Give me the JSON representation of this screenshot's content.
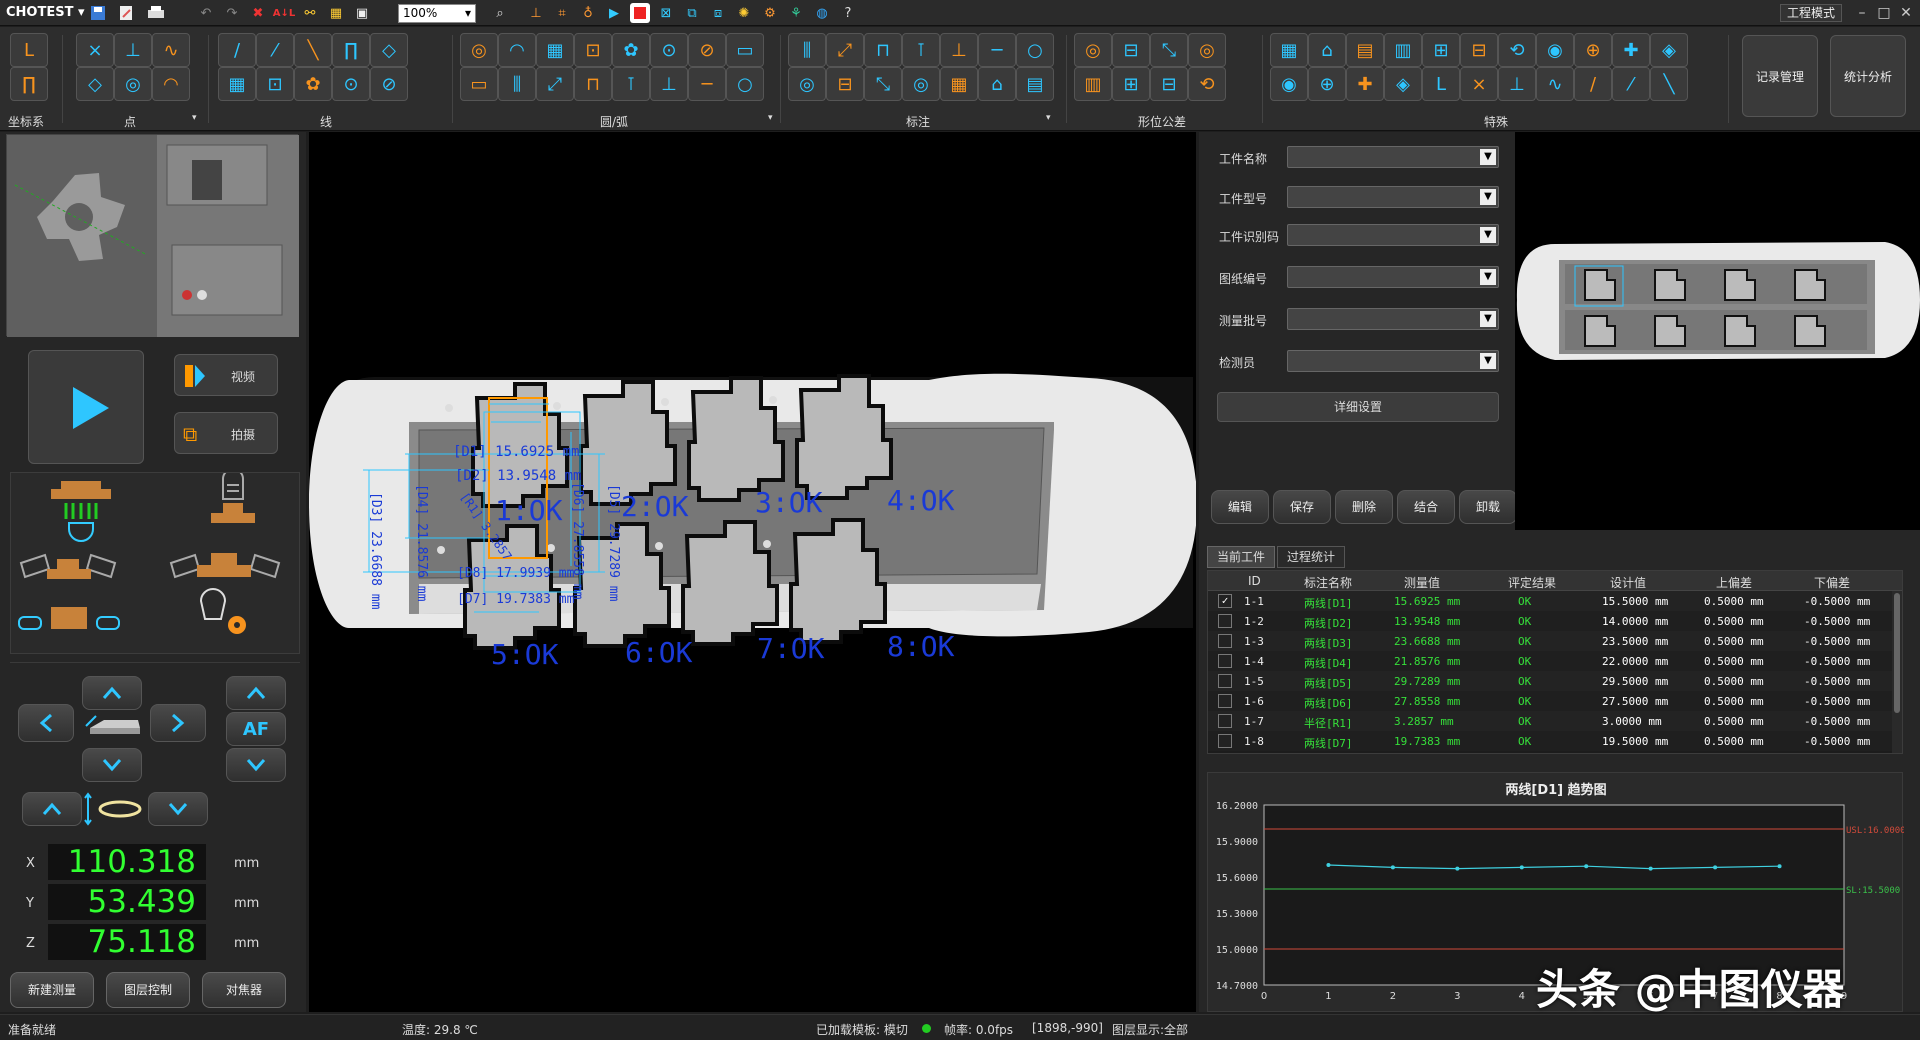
{
  "app": {
    "name": "CHOTEST",
    "mode_label": "工程模式",
    "zoom": "100%"
  },
  "ribbon": {
    "groups": [
      "坐标系",
      "点",
      "线",
      "圆/弧",
      "标注",
      "形位公差",
      "特殊"
    ],
    "big_buttons": [
      "记录管理",
      "统计分析"
    ]
  },
  "left": {
    "video_label": "视频",
    "capture_label": "拍摄",
    "af_label": "AF",
    "coords": [
      {
        "axis": "X",
        "value": "110.318",
        "unit": "mm"
      },
      {
        "axis": "Y",
        "value": "53.439",
        "unit": "mm"
      },
      {
        "axis": "Z",
        "value": "75.118",
        "unit": "mm"
      }
    ],
    "bottom_buttons": [
      "新建测量",
      "图层控制",
      "对焦器"
    ]
  },
  "canvas": {
    "results": [
      "1:OK",
      "2:OK",
      "3:OK",
      "4:OK",
      "5:OK",
      "6:OK",
      "7:OK",
      "8:OK"
    ],
    "dims": {
      "d1": "[D1] 15.6925 mm",
      "d2": "[D2] 13.9548 mm",
      "d3": "[D3] 23.6688 mm",
      "d4": "[D4] 21.8576 mm",
      "d5": "[D5] 29.7289 mm",
      "d6": "[D6] 27.8558 mm",
      "d7": "[D7] 19.7383 mm",
      "d8": "[D8] 17.9939 mm",
      "r1": "[R1] 3.2857"
    }
  },
  "right": {
    "fields": [
      "工件名称",
      "工件型号",
      "工件识别码",
      "图纸编号",
      "测量批号",
      "检测员"
    ],
    "detail_button": "详细设置",
    "actions": [
      "编辑",
      "保存",
      "删除",
      "结合",
      "卸载"
    ],
    "tabs": [
      "当前工件",
      "过程统计"
    ],
    "table": {
      "headers": [
        "ID",
        "标注名称",
        "测量值",
        "评定结果",
        "设计值",
        "上偏差",
        "下偏差"
      ],
      "rows": [
        {
          "id": "1-1",
          "name": "两线[D1]",
          "measured": "15.6925 mm",
          "result": "OK",
          "design": "15.5000 mm",
          "upper": "0.5000 mm",
          "lower": "-0.5000 mm",
          "checked": true
        },
        {
          "id": "1-2",
          "name": "两线[D2]",
          "measured": "13.9548 mm",
          "result": "OK",
          "design": "14.0000 mm",
          "upper": "0.5000 mm",
          "lower": "-0.5000 mm",
          "checked": false
        },
        {
          "id": "1-3",
          "name": "两线[D3]",
          "measured": "23.6688 mm",
          "result": "OK",
          "design": "23.5000 mm",
          "upper": "0.5000 mm",
          "lower": "-0.5000 mm",
          "checked": false
        },
        {
          "id": "1-4",
          "name": "两线[D4]",
          "measured": "21.8576 mm",
          "result": "OK",
          "design": "22.0000 mm",
          "upper": "0.5000 mm",
          "lower": "-0.5000 mm",
          "checked": false
        },
        {
          "id": "1-5",
          "name": "两线[D5]",
          "measured": "29.7289 mm",
          "result": "OK",
          "design": "29.5000 mm",
          "upper": "0.5000 mm",
          "lower": "-0.5000 mm",
          "checked": false
        },
        {
          "id": "1-6",
          "name": "两线[D6]",
          "measured": "27.8558 mm",
          "result": "OK",
          "design": "27.5000 mm",
          "upper": "0.5000 mm",
          "lower": "-0.5000 mm",
          "checked": false
        },
        {
          "id": "1-7",
          "name": "半径[R1]",
          "measured": "3.2857 mm",
          "result": "OK",
          "design": "3.0000 mm",
          "upper": "0.5000 mm",
          "lower": "-0.5000 mm",
          "checked": false
        },
        {
          "id": "1-8",
          "name": "两线[D7]",
          "measured": "19.7383 mm",
          "result": "OK",
          "design": "19.5000 mm",
          "upper": "0.5000 mm",
          "lower": "-0.5000 mm",
          "checked": false
        }
      ]
    }
  },
  "chart_data": {
    "type": "line",
    "title": "两线[D1] 趋势图",
    "x": [
      1,
      2,
      3,
      4,
      5,
      6,
      7,
      8
    ],
    "values": [
      15.7,
      15.68,
      15.67,
      15.68,
      15.69,
      15.67,
      15.68,
      15.69
    ],
    "xlim": [
      0,
      9
    ],
    "ylim": [
      14.7,
      16.2
    ],
    "yticks": [
      "16.2000",
      "15.9000",
      "15.6000",
      "15.3000",
      "15.0000",
      "14.7000"
    ],
    "xticks": [
      "0",
      "1",
      "2",
      "3",
      "4",
      "5",
      "6",
      "7",
      "8",
      "9"
    ],
    "usl_label": "USL:16.0000",
    "usl": 16.0,
    "sl_label": "SL:15.5000",
    "sl": 15.5,
    "lsl": 15.0,
    "series_color": "#3fd0e0",
    "limit_color": "#d04a3a",
    "sl_color": "#3ac04a"
  },
  "status": {
    "ready": "准备就绪",
    "temp": "温度: 29.8 ℃",
    "template": "已加载模板: 模切",
    "fps": "帧率: 0.0fps",
    "pos": "[1898,-990]",
    "layer": "图层显示:全部"
  },
  "watermark": "头条 @中图仪器"
}
